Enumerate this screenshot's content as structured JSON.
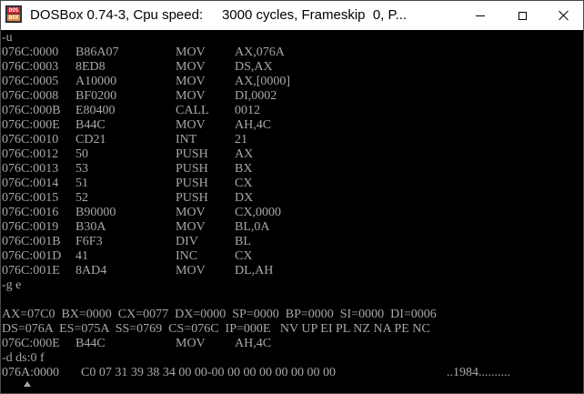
{
  "window": {
    "icon_text": [
      "DOS",
      "BOX"
    ],
    "title": "DOSBox 0.74-3, Cpu speed:     3000 cycles, Frameskip  0, P..."
  },
  "console": {
    "lines": [
      {
        "type": "cmd",
        "text": "-u"
      },
      {
        "type": "asm",
        "addr": "076C:0000",
        "bytes": "B86A07",
        "op": "MOV",
        "args": "AX,076A"
      },
      {
        "type": "asm",
        "addr": "076C:0003",
        "bytes": "8ED8",
        "op": "MOV",
        "args": "DS,AX"
      },
      {
        "type": "asm",
        "addr": "076C:0005",
        "bytes": "A10000",
        "op": "MOV",
        "args": "AX,[0000]"
      },
      {
        "type": "asm",
        "addr": "076C:0008",
        "bytes": "BF0200",
        "op": "MOV",
        "args": "DI,0002"
      },
      {
        "type": "asm",
        "addr": "076C:000B",
        "bytes": "E80400",
        "op": "CALL",
        "args": "0012"
      },
      {
        "type": "asm",
        "addr": "076C:000E",
        "bytes": "B44C",
        "op": "MOV",
        "args": "AH,4C"
      },
      {
        "type": "asm",
        "addr": "076C:0010",
        "bytes": "CD21",
        "op": "INT",
        "args": "21"
      },
      {
        "type": "asm",
        "addr": "076C:0012",
        "bytes": "50",
        "op": "PUSH",
        "args": "AX"
      },
      {
        "type": "asm",
        "addr": "076C:0013",
        "bytes": "53",
        "op": "PUSH",
        "args": "BX"
      },
      {
        "type": "asm",
        "addr": "076C:0014",
        "bytes": "51",
        "op": "PUSH",
        "args": "CX"
      },
      {
        "type": "asm",
        "addr": "076C:0015",
        "bytes": "52",
        "op": "PUSH",
        "args": "DX"
      },
      {
        "type": "asm",
        "addr": "076C:0016",
        "bytes": "B90000",
        "op": "MOV",
        "args": "CX,0000"
      },
      {
        "type": "asm",
        "addr": "076C:0019",
        "bytes": "B30A",
        "op": "MOV",
        "args": "BL,0A"
      },
      {
        "type": "asm",
        "addr": "076C:001B",
        "bytes": "F6F3",
        "op": "DIV",
        "args": "BL"
      },
      {
        "type": "asm",
        "addr": "076C:001D",
        "bytes": "41",
        "op": "INC",
        "args": "CX"
      },
      {
        "type": "asm",
        "addr": "076C:001E",
        "bytes": "8AD4",
        "op": "MOV",
        "args": "DL,AH"
      },
      {
        "type": "cmd",
        "text": "-g e"
      },
      {
        "type": "blank",
        "text": ""
      },
      {
        "type": "text",
        "text": "AX=07C0  BX=0000  CX=0077  DX=0000  SP=0000  BP=0000  SI=0000  DI=0006"
      },
      {
        "type": "text",
        "text": "DS=076A  ES=075A  SS=0769  CS=076C  IP=000E   NV UP EI PL NZ NA PE NC"
      },
      {
        "type": "asm",
        "addr": "076C:000E",
        "bytes": "B44C",
        "op": "MOV",
        "args": "AH,4C"
      },
      {
        "type": "cmd",
        "text": "-d ds:0 f"
      },
      {
        "type": "dump",
        "addr": "076A:0000",
        "hex": "C0 07 31 39 38 34 00 00-00 00 00 00 00 00 00 00",
        "ascii": "..1984.........."
      }
    ]
  },
  "icons": {
    "app": "dosbox-icon",
    "minimize": "minimize-icon",
    "maximize": "maximize-icon",
    "close": "close-icon",
    "cursor": "mouse-cursor-icon"
  }
}
